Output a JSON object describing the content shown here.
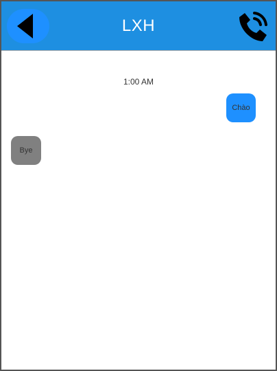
{
  "header": {
    "title": "LXH",
    "background_color": "#1e8fe1",
    "back_icon": "back-arrow-icon",
    "call_icon": "phone-call-icon"
  },
  "chat": {
    "timestamp": "1:00 AM",
    "messages": [
      {
        "direction": "sent",
        "text": "Chào",
        "color": "#1e90ff"
      },
      {
        "direction": "received",
        "text": "Bye",
        "color": "#808080"
      }
    ]
  }
}
